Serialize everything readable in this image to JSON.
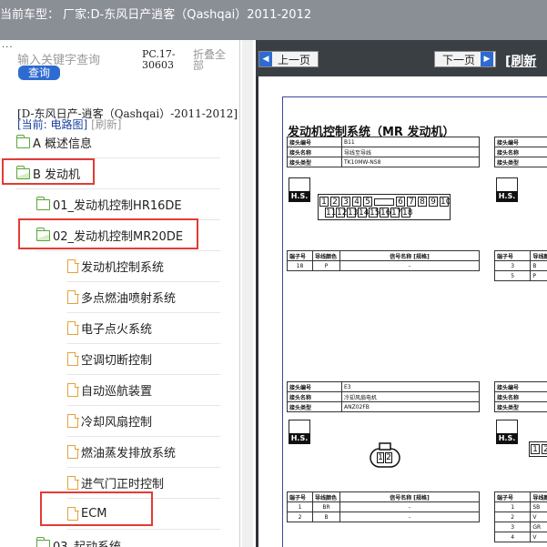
{
  "header": {
    "title": "当前车型： 厂家:D-东风日产逍客（Qashqai）2011-2012"
  },
  "left_panel": {
    "dots": "...",
    "search": {
      "placeholder": "输入关键字查询",
      "button_label": "查询"
    },
    "pc_version": "PC.17-30603",
    "collapse_all_label": "折叠全部",
    "path": "[D-东风日产-逍客（Qashqai）-2011-2012]",
    "current_label": "[当前: 电路图]",
    "refresh_label": "[刷新]",
    "tree": [
      {
        "label": "A 概述信息",
        "type": "folder"
      },
      {
        "label": "B 发动机",
        "type": "folder-open"
      },
      {
        "label": "01_发动机控制HR16DE",
        "type": "folder"
      },
      {
        "label": "02_发动机控制MR20DE",
        "type": "folder-open"
      },
      {
        "label": "发动机控制系统",
        "type": "doc"
      },
      {
        "label": "多点燃油喷射系统",
        "type": "doc"
      },
      {
        "label": "电子点火系统",
        "type": "doc"
      },
      {
        "label": "空调切断控制",
        "type": "doc"
      },
      {
        "label": "自动巡航装置",
        "type": "doc"
      },
      {
        "label": "冷却风扇控制",
        "type": "doc"
      },
      {
        "label": "燃油蒸发排放系统",
        "type": "doc"
      },
      {
        "label": "进气门正时控制",
        "type": "doc"
      },
      {
        "label": "ECM",
        "type": "doc"
      },
      {
        "label": "03_起动系统",
        "type": "folder"
      }
    ]
  },
  "viewer": {
    "prev_label": "上一页",
    "next_label": "下一页",
    "refresh_label": "[刷新",
    "arrow_left": "◀",
    "arrow_right": "▶",
    "sheet": {
      "title": "发动机控制系统（MR 发动机）",
      "hs_label": "H.S.",
      "conn1": {
        "rows": [
          [
            "接头编号",
            "B11"
          ],
          [
            "接头名称",
            "导线至导线"
          ],
          [
            "接头类型",
            "TK10MW-NS8"
          ]
        ],
        "pins_top": [
          "1",
          "2",
          "3",
          "4",
          "5",
          "6",
          "7",
          "8",
          "9",
          "10"
        ],
        "pins_bottom": [
          "11",
          "12",
          "13",
          "14",
          "15",
          "16",
          "17",
          "18"
        ]
      },
      "table1": {
        "headers": [
          "端子号",
          "导线颜色",
          "信号名称 [规格]"
        ],
        "rows": [
          [
            "18",
            "P",
            "-"
          ]
        ]
      },
      "right_table1": {
        "rows": [
          [
            "接头编号",
            ""
          ],
          [
            "接头名称",
            ""
          ],
          [
            "接头类型",
            ""
          ]
        ]
      },
      "right_pin_table1": {
        "headers": [
          "端子号",
          "导线颜色"
        ],
        "rows": [
          [
            "3",
            "B"
          ],
          [
            "5",
            "P"
          ]
        ]
      },
      "conn2": {
        "rows": [
          [
            "接头编号",
            "E3"
          ],
          [
            "接头名称",
            "冷却风扇电机"
          ],
          [
            "接头类型",
            "ANZ02FB"
          ]
        ],
        "pins": [
          "1",
          "2"
        ]
      },
      "right_table2": {
        "rows": [
          [
            "接头编号",
            ""
          ],
          [
            "接头名称",
            ""
          ],
          [
            "接头类型",
            ""
          ]
        ]
      },
      "right_conn2_pins": [
        "1",
        "2"
      ],
      "table2": {
        "headers": [
          "端子号",
          "导线颜色",
          "信号名称 [规格]"
        ],
        "rows": [
          [
            "1",
            "BR",
            "-"
          ],
          [
            "2",
            "B",
            "-"
          ]
        ]
      },
      "right_pin_table2": {
        "headers": [
          "端子号",
          "导线颜色"
        ],
        "rows": [
          [
            "1",
            "SB"
          ],
          [
            "2",
            "V"
          ],
          [
            "3",
            "GR"
          ],
          [
            "4",
            "V"
          ]
        ]
      }
    }
  }
}
